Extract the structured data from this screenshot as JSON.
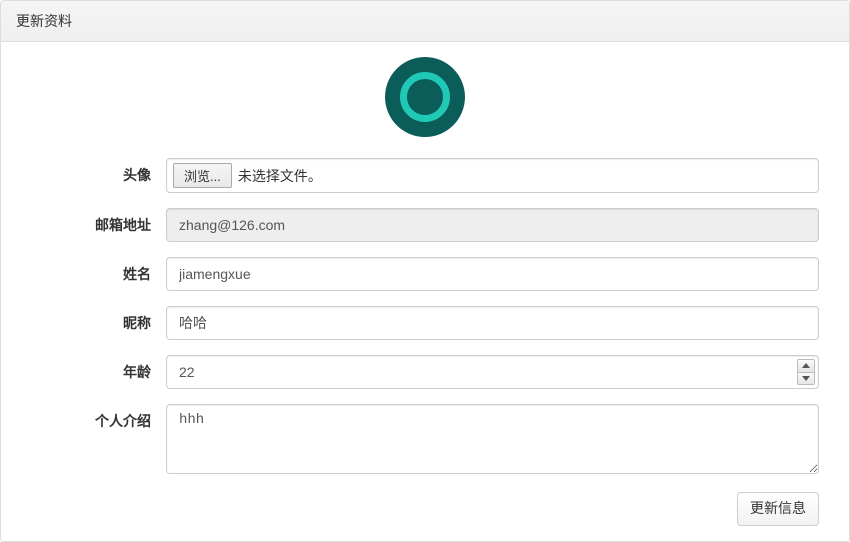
{
  "panel": {
    "title": "更新资料"
  },
  "form": {
    "avatar": {
      "label": "头像",
      "browse_button": "浏览...",
      "file_status": "未选择文件。"
    },
    "email": {
      "label": "邮箱地址",
      "value": "zhang@126.com"
    },
    "name": {
      "label": "姓名",
      "value": "jiamengxue"
    },
    "nickname": {
      "label": "昵称",
      "value": "哈哈"
    },
    "age": {
      "label": "年龄",
      "value": "22"
    },
    "bio": {
      "label": "个人介绍",
      "value": "hhh"
    },
    "submit_label": "更新信息"
  }
}
